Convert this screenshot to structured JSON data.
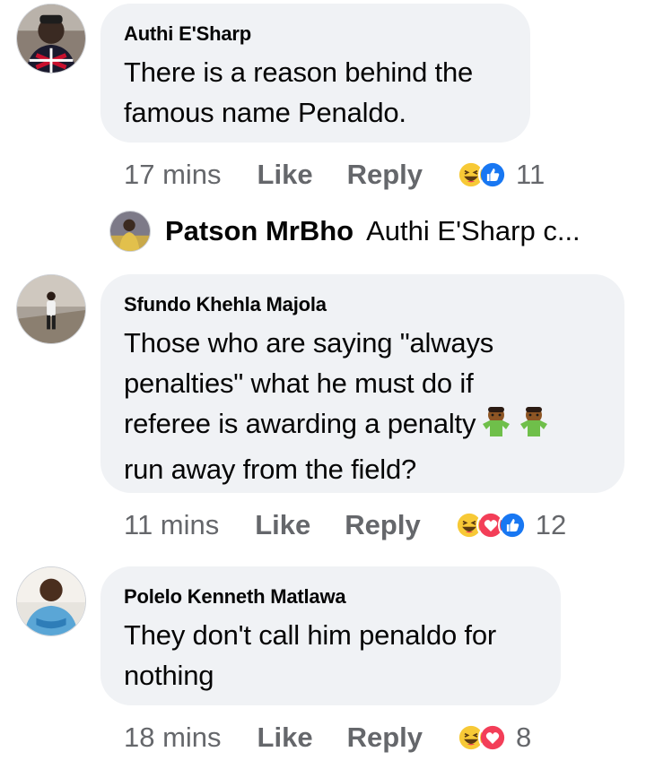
{
  "comments": [
    {
      "author": "Authi E'Sharp",
      "lines": [
        "There is a reason behind the",
        "famous name Penaldo."
      ],
      "time": "17 mins",
      "like_label": "Like",
      "reply_label": "Reply",
      "reactions": [
        "haha",
        "like"
      ],
      "reaction_count": "11"
    },
    {
      "author": "Sfundo Khehla Majola",
      "lines": [
        "Those who are saying \"always",
        "penalties\" what he must do if",
        "referee is awarding a penalty",
        "run away from the field?"
      ],
      "time": "11 mins",
      "like_label": "Like",
      "reply_label": "Reply",
      "reactions": [
        "haha",
        "love",
        "like"
      ],
      "reaction_count": "12"
    },
    {
      "author": "Polelo Kenneth Matlawa",
      "lines": [
        "They don't call him penaldo for",
        "nothing"
      ],
      "time": "18 mins",
      "like_label": "Like",
      "reply_label": "Reply",
      "reactions": [
        "haha",
        "love"
      ],
      "reaction_count": "8"
    }
  ],
  "reply_preview": {
    "name": "Patson MrBho",
    "snippet": "Authi E'Sharp c..."
  },
  "inline_emoji": "man-shrugging-emoji",
  "colors": {
    "bubble": "#f0f2f5",
    "meta": "#65676b",
    "like_blue": "#1877f2",
    "love_red": "#f33e58",
    "haha_yellow": "#f7c936"
  }
}
